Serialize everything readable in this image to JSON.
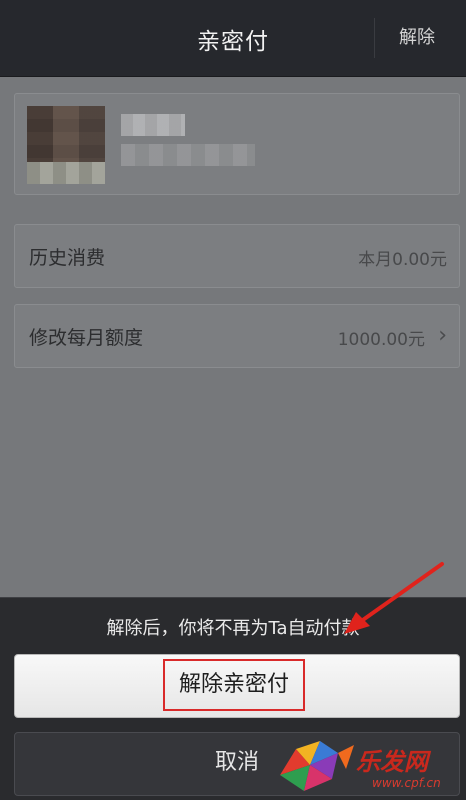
{
  "titlebar": {
    "title": "亲密付",
    "release_label": "解除"
  },
  "history_row": {
    "label": "历史消费",
    "value": "本月0.00元"
  },
  "limit_row": {
    "label": "修改每月额度",
    "value": "1000.00元"
  },
  "sheet": {
    "message": "解除后，你将不再为Ta自动付款",
    "confirm_label": "解除亲密付",
    "cancel_label": "取消"
  },
  "watermark": {
    "brand_text": "乐发网",
    "url": "www.cpf.cn"
  },
  "colors": {
    "highlight_red": "#d92a2a",
    "arrow_red": "#e0231c"
  },
  "icons": [
    "chevron-right-icon",
    "annotation-arrow-icon",
    "watermark-logo-icon"
  ]
}
